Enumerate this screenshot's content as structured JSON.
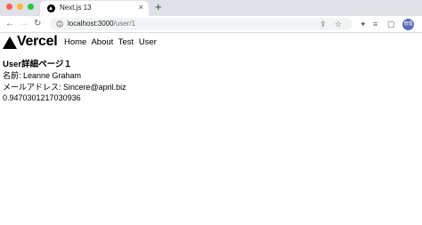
{
  "browser": {
    "tab": {
      "title": "Next.js 13",
      "close_glyph": "×"
    },
    "new_tab_glyph": "+",
    "nav": {
      "back_glyph": "←",
      "forward_glyph": "→",
      "reload_glyph": "↻"
    },
    "url": {
      "host": "localhost:3000",
      "path": "/user/1"
    },
    "omnibox_icons": {
      "share_glyph": "⇪",
      "star_glyph": "☆"
    },
    "toolbar_icons": {
      "extensions_glyph": "✦",
      "playlist_glyph": "≡",
      "sidebar_glyph": "▢",
      "menu_glyph": "⋮"
    },
    "profile": {
      "initials": "管理",
      "color": "#5a6ab8"
    }
  },
  "site": {
    "logo_text": "Vercel",
    "nav": {
      "home": "Home",
      "about": "About",
      "test": "Test",
      "user": "User"
    }
  },
  "page": {
    "title": "User詳細ページ１",
    "name_line": "名前: Leanne Graham",
    "email_line": "メールアドレス: Sincere@april.biz",
    "random_value": "0.9470301217030936"
  }
}
